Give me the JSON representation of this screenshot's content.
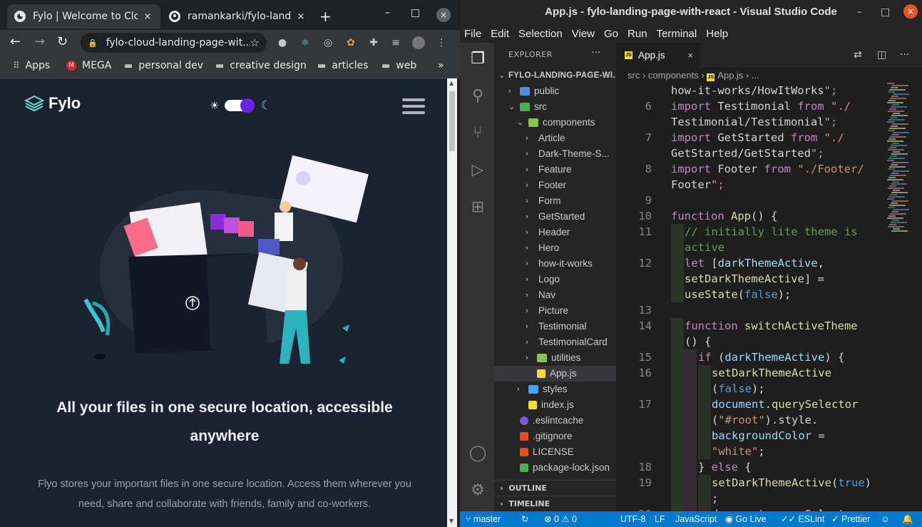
{
  "chrome": {
    "tabs": [
      {
        "title": "Fylo | Welcome to Clou",
        "close": "×"
      },
      {
        "title": "ramankarki/fylo-landi",
        "close": "×"
      }
    ],
    "new_tab": "+",
    "win_minimize": "–",
    "win_maximize": "□",
    "win_close": "×",
    "nav": {
      "back": "←",
      "forward": "→",
      "reload": "↻"
    },
    "url": "fylo-cloud-landing-page-wit...",
    "bookmarks": [
      {
        "label": "Apps",
        "icon": "apps-grid-icon"
      },
      {
        "label": "MEGA",
        "icon": "mega-icon"
      },
      {
        "label": "personal dev",
        "icon": "folder-icon"
      },
      {
        "label": "creative design",
        "icon": "folder-icon"
      },
      {
        "label": "articles",
        "icon": "folder-icon"
      },
      {
        "label": "web",
        "icon": "folder-icon"
      }
    ],
    "bookmarks_more": "»"
  },
  "site": {
    "logo_text": "Fylo",
    "headline": "All your files in one secure location, accessible anywhere",
    "subtext": "Flyo stores your important files in one secure location. Access them wherever you need, share and collaborate with friends, family and co-workers.",
    "colors": {
      "background": "#1c2330",
      "accent": "#6a24e6",
      "moon": "#65e2d9",
      "text": "#eef0f3"
    }
  },
  "vscode": {
    "title": "App.js - fylo-landing-page-with-react - Visual Studio Code",
    "menu": [
      "File",
      "Edit",
      "Selection",
      "View",
      "Go",
      "Run",
      "Terminal",
      "Help"
    ],
    "explorer": {
      "title": "EXPLORER",
      "more": "···",
      "project": "FYLO-LANDING-PAGE-WI...",
      "items": [
        {
          "label": "public",
          "type": "folder",
          "depth": 1,
          "open": false,
          "icon": "public-folder-icon"
        },
        {
          "label": "src",
          "type": "folder",
          "depth": 1,
          "open": true,
          "icon": "src-folder-icon"
        },
        {
          "label": "components",
          "type": "folder",
          "depth": 2,
          "open": true,
          "icon": "components-folder-icon"
        },
        {
          "label": "Article",
          "type": "folder",
          "depth": 3
        },
        {
          "label": "Dark-Theme-S...",
          "type": "folder",
          "depth": 3
        },
        {
          "label": "Feature",
          "type": "folder",
          "depth": 3
        },
        {
          "label": "Footer",
          "type": "folder",
          "depth": 3
        },
        {
          "label": "Form",
          "type": "folder",
          "depth": 3
        },
        {
          "label": "GetStarted",
          "type": "folder",
          "depth": 3
        },
        {
          "label": "Header",
          "type": "folder",
          "depth": 3
        },
        {
          "label": "Hero",
          "type": "folder",
          "depth": 3
        },
        {
          "label": "how-it-works",
          "type": "folder",
          "depth": 3
        },
        {
          "label": "Logo",
          "type": "folder",
          "depth": 3
        },
        {
          "label": "Nav",
          "type": "folder",
          "depth": 3
        },
        {
          "label": "Picture",
          "type": "folder",
          "depth": 3
        },
        {
          "label": "Testimonial",
          "type": "folder",
          "depth": 3
        },
        {
          "label": "TestimonialCard",
          "type": "folder",
          "depth": 3
        },
        {
          "label": "utilities",
          "type": "folder",
          "depth": 3,
          "icon": "utilities-folder-icon"
        },
        {
          "label": "App.js",
          "type": "js",
          "depth": 3,
          "selected": true
        },
        {
          "label": "styles",
          "type": "folder",
          "depth": 2,
          "icon": "styles-folder-icon"
        },
        {
          "label": "index.js",
          "type": "js",
          "depth": 2
        },
        {
          "label": ".eslintcache",
          "type": "eslint",
          "depth": 1
        },
        {
          "label": ".gitignore",
          "type": "git",
          "depth": 1
        },
        {
          "label": "LICENSE",
          "type": "license",
          "depth": 1
        },
        {
          "label": "package-lock.json",
          "type": "npm",
          "depth": 1
        }
      ],
      "outline": "OUTLINE",
      "timeline": "TIMELINE"
    },
    "tab": {
      "name": "App.js",
      "close": "×"
    },
    "breadcrumb": [
      "src",
      "components",
      "App.js",
      "..."
    ],
    "code_lines": [
      {
        "n": "",
        "text": "how-it-works/HowItWorks\";"
      },
      {
        "n": "6",
        "text": "import Testimonial from \"./"
      },
      {
        "n": "",
        "text": "Testimonial/Testimonial\";"
      },
      {
        "n": "7",
        "text": "import GetStarted from \"./"
      },
      {
        "n": "",
        "text": "GetStarted/GetStarted\";"
      },
      {
        "n": "8",
        "text": "import Footer from \"./Footer/"
      },
      {
        "n": "",
        "text": "Footer\";"
      },
      {
        "n": "9",
        "text": ""
      },
      {
        "n": "10",
        "text": "function App() {"
      },
      {
        "n": "11",
        "text": "// initially lite theme is"
      },
      {
        "n": "",
        "text": "active"
      },
      {
        "n": "12",
        "text": "let [darkThemeActive,"
      },
      {
        "n": "",
        "text": "setDarkThemeActive] ="
      },
      {
        "n": "",
        "text": "useState(false);"
      },
      {
        "n": "13",
        "text": ""
      },
      {
        "n": "14",
        "text": "function switchActiveTheme"
      },
      {
        "n": "",
        "text": "() {"
      },
      {
        "n": "15",
        "text": "if (darkThemeActive) {"
      },
      {
        "n": "16",
        "text": "setDarkThemeActive"
      },
      {
        "n": "",
        "text": "(false);"
      },
      {
        "n": "17",
        "text": "document.querySelector"
      },
      {
        "n": "",
        "text": "(\"#root\").style."
      },
      {
        "n": "",
        "text": "backgroundColor ="
      },
      {
        "n": "",
        "text": "\"white\";"
      },
      {
        "n": "18",
        "text": "} else {"
      },
      {
        "n": "19",
        "text": "setDarkThemeActive(true)"
      },
      {
        "n": "",
        "text": ";"
      },
      {
        "n": "20",
        "text": "document.querySelector"
      }
    ],
    "status": {
      "branch": "master",
      "sync": "↻",
      "problems": "⊗ 0 ⚠ 0",
      "encoding": "UTF-8",
      "eol": "LF",
      "language": "JavaScript",
      "golive": "Go Live",
      "eslint": "ESLint",
      "prettier": "Prettier",
      "status_color": "#007acc"
    }
  }
}
